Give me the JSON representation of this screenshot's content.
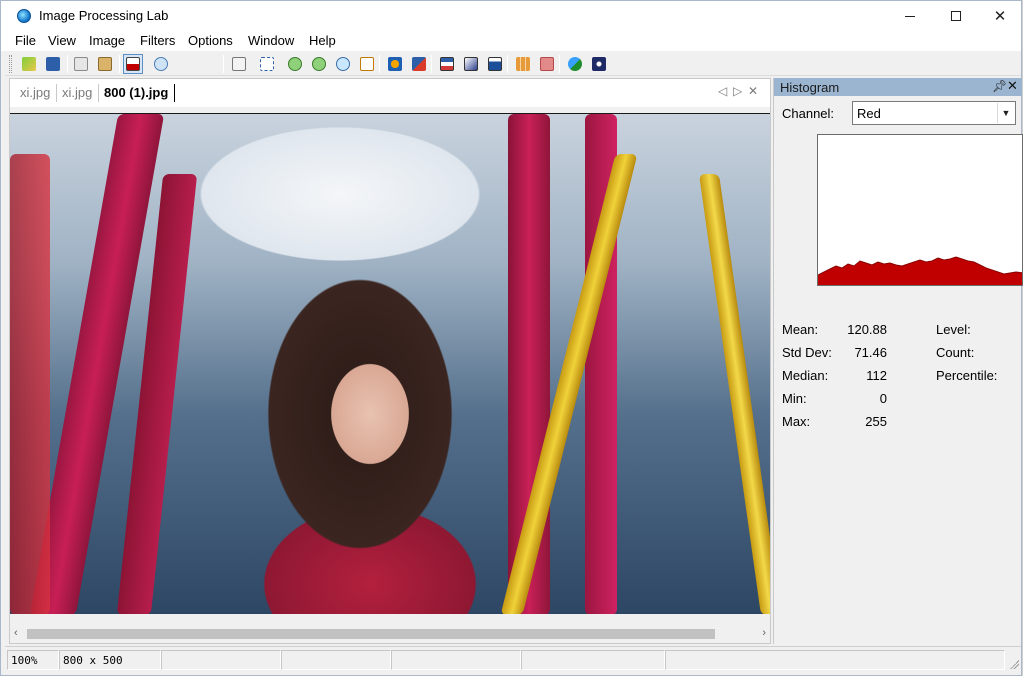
{
  "window": {
    "title": "Image Processing Lab"
  },
  "menu": [
    "File",
    "View",
    "Image",
    "Filters",
    "Options",
    "Window",
    "Help"
  ],
  "toolbar": {
    "buttons": [
      "open-icon",
      "save-icon",
      "copy-icon",
      "paste-icon",
      "histogram-view-icon",
      "image-info-icon",
      "new-from-clipboard-icon",
      "select-all-icon",
      "zoom-in-icon",
      "zoom-out-icon",
      "zoom-original-icon",
      "fit-to-window-icon",
      "move-icon",
      "rotate-icon",
      "levels-icon",
      "grayscale-icon",
      "brightness-icon",
      "grid-icon",
      "noise-icon",
      "color-icon",
      "effect-icon"
    ]
  },
  "tabs": [
    {
      "label": "xi.jpg",
      "active": false
    },
    {
      "label": "xi.jpg",
      "active": false
    },
    {
      "label": "800 (1).jpg",
      "active": true
    }
  ],
  "histogram": {
    "title": "Histogram",
    "channel_label": "Channel:",
    "channel_value": "Red",
    "accent_color": "#c00000",
    "stats": {
      "mean_label": "Mean:",
      "mean": "120.88",
      "stddev_label": "Std Dev:",
      "stddev": "71.46",
      "median_label": "Median:",
      "median": "112",
      "min_label": "Min:",
      "min": "0",
      "max_label": "Max:",
      "max": "255",
      "level_label": "Level:",
      "count_label": "Count:",
      "percentile_label": "Percentile:"
    }
  },
  "statusbar": {
    "zoom": "100%",
    "size": "800 x 500"
  },
  "icons": {
    "close": "close-icon",
    "minimize": "minimize-icon",
    "maximize": "maximize-icon",
    "pin": "pin-icon",
    "dropdown": "chevron-down-icon",
    "tab_prev": "chevron-left-icon",
    "tab_next": "chevron-right-icon",
    "tab_close": "close-icon",
    "scroll_left": "scroll-left-icon",
    "scroll_right": "scroll-right-icon"
  }
}
